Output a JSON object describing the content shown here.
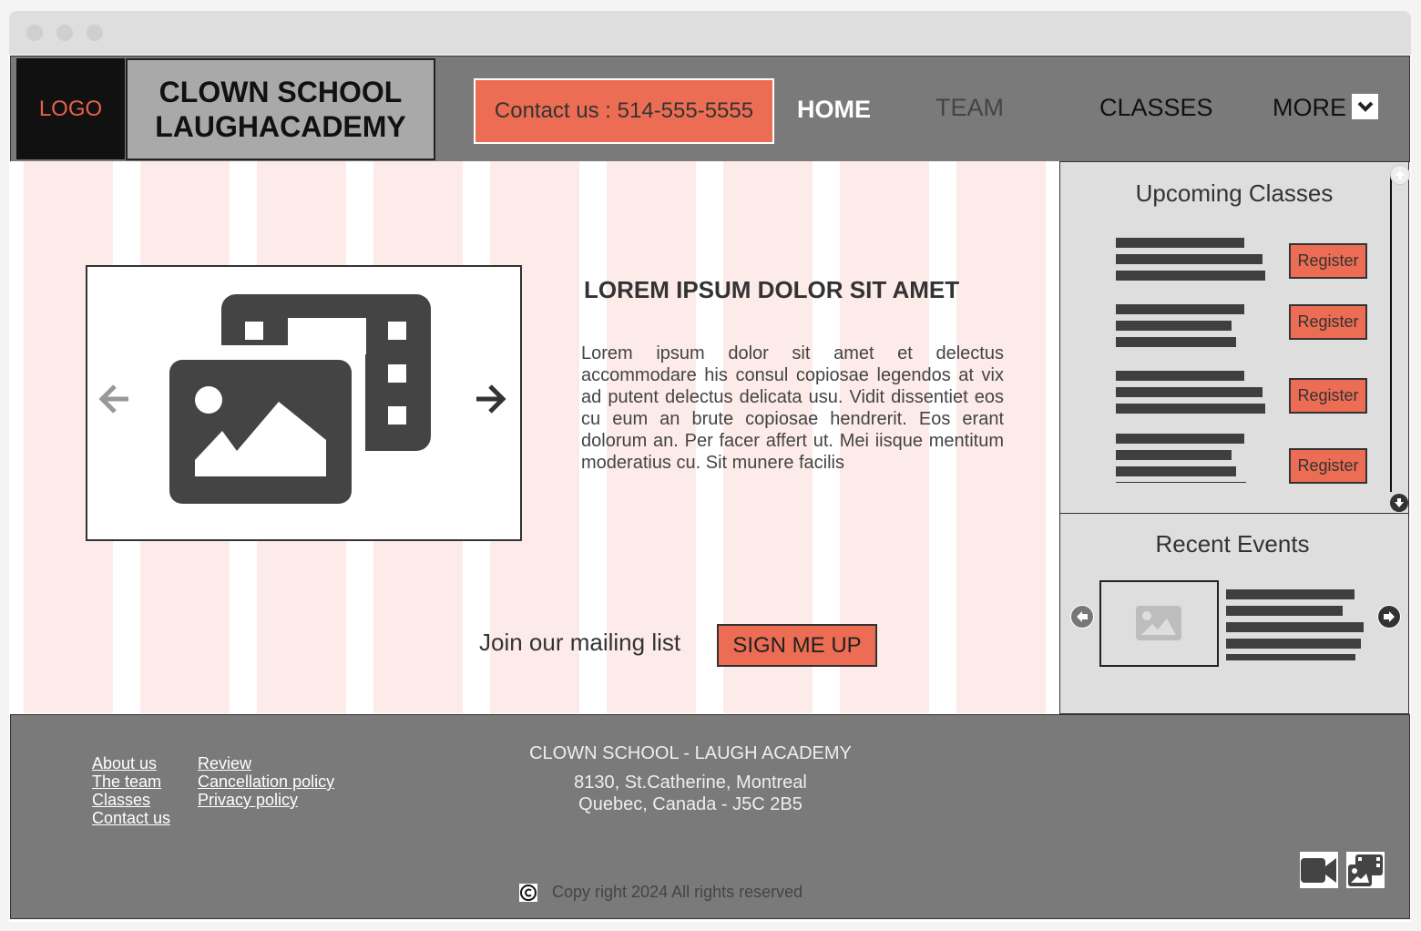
{
  "header": {
    "logo": "LOGO",
    "school_line1": "CLOWN SCHOOL",
    "school_line2": "LAUGHACADEMY",
    "contact": "Contact us : 514-555-5555",
    "nav": {
      "home": "HOME",
      "team": "TEAM",
      "classes": "CLASSES",
      "more": "MORE"
    }
  },
  "main": {
    "heading": "LOREM IPSUM DOLOR SIT AMET",
    "paragraph": "Lorem ipsum dolor sit amet et delectus accommodare his consul copiosae legendos at vix ad putent delectus delicata usu. Vidit dissentiet eos cu eum an brute copiosae hendrerit. Eos erant dolorum an. Per facer affert ut. Mei iisque mentitum moderatius cu. Sit munere facilis",
    "mailing_label": "Join our mailing list",
    "signup_button": "SIGN ME UP"
  },
  "sidebar": {
    "upcoming_title": "Upcoming Classes",
    "register_label": "Register",
    "recent_title": "Recent Events"
  },
  "footer": {
    "links_col1": [
      "About us",
      "The team",
      "Classes",
      "Contact us"
    ],
    "links_col2": [
      "Review",
      "Cancellation policy",
      "Privacy policy"
    ],
    "school_name": "CLOWN SCHOOL - LAUGH ACADEMY",
    "address_line1": "8130, St.Catherine, Montreal",
    "address_line2": "Quebec, Canada - J5C 2B5",
    "copyright": "Copy right 2024 All rights reserved"
  },
  "colors": {
    "accent": "#ec6d53",
    "header_bg": "#7a7a7a",
    "stripe": "#fcebe9",
    "sidebar_bg": "#dedede"
  },
  "icons": [
    "media-gallery-icon",
    "arrow-left-icon",
    "arrow-right-icon",
    "chevron-down-icon",
    "scroll-up-icon",
    "scroll-down-icon",
    "image-icon",
    "copyright-icon",
    "video-icon",
    "gallery-icon"
  ]
}
